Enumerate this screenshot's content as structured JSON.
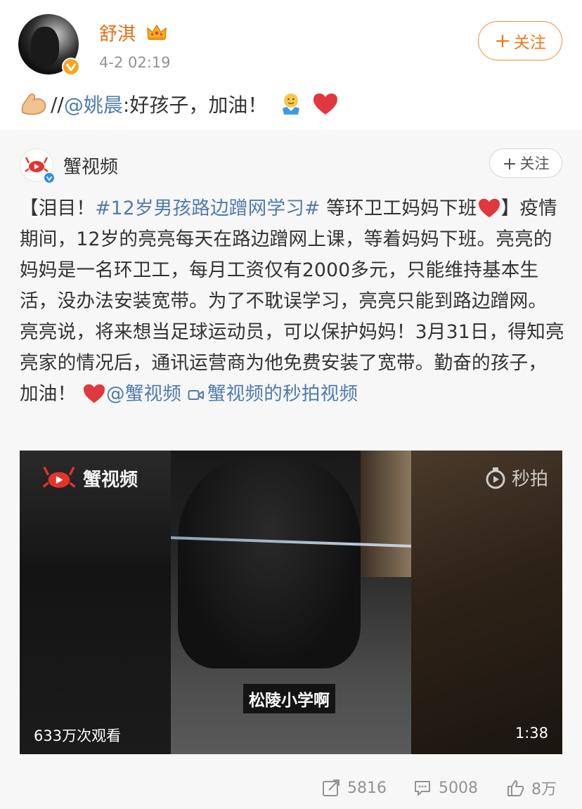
{
  "author": {
    "name": "舒淇",
    "time": "4-2 02:19",
    "follow_label": "关注",
    "follow_plus": "+"
  },
  "comment": {
    "prefix": "//",
    "mention": "@姚晨",
    "text": ":好孩子，加油！"
  },
  "original": {
    "author_name": "蟹视频",
    "follow_label": "关注",
    "follow_plus": "+",
    "text_open": "【泪目！",
    "hashtag": "#12岁男孩路边蹭网学习#",
    "text_after_hashtag": " 等环卫工妈妈下班",
    "text_body": "】疫情期间，12岁的亮亮每天在路边蹭网上课，等着妈妈下班。亮亮的妈妈是一名环卫工，每月工资仅有2000多元，只能维持基本生活，没办法安装宽带。为了不耽误学习，亮亮只能到路边蹭网。亮亮说，将来想当足球运动员，可以保护妈妈！3月31日，得知亮亮家的情况后，通讯运营商为他免费安装了宽带。勤奋的孩子，加油！",
    "mention": "@蟹视频",
    "video_link": "蟹视频的秒拍视频"
  },
  "video": {
    "logo_text": "蟹视频",
    "watermark": "秒拍",
    "subtitle": "松陵小学啊",
    "views": "633万次观看",
    "duration": "1:38"
  },
  "actions": {
    "repost_count": "5816",
    "comment_count": "5008",
    "like_count": "8万"
  },
  "icons": {
    "verified": "verified-badge-icon",
    "crown": "crown-icon",
    "repost": "repost-icon",
    "comment": "comment-icon",
    "like": "thumbs-up-icon"
  },
  "colors": {
    "author_name": "#e86b0e",
    "link": "#4f7cae",
    "follow_accent": "#f0791a",
    "meta": "#939393",
    "quoted_bg": "#f7f7f7"
  }
}
